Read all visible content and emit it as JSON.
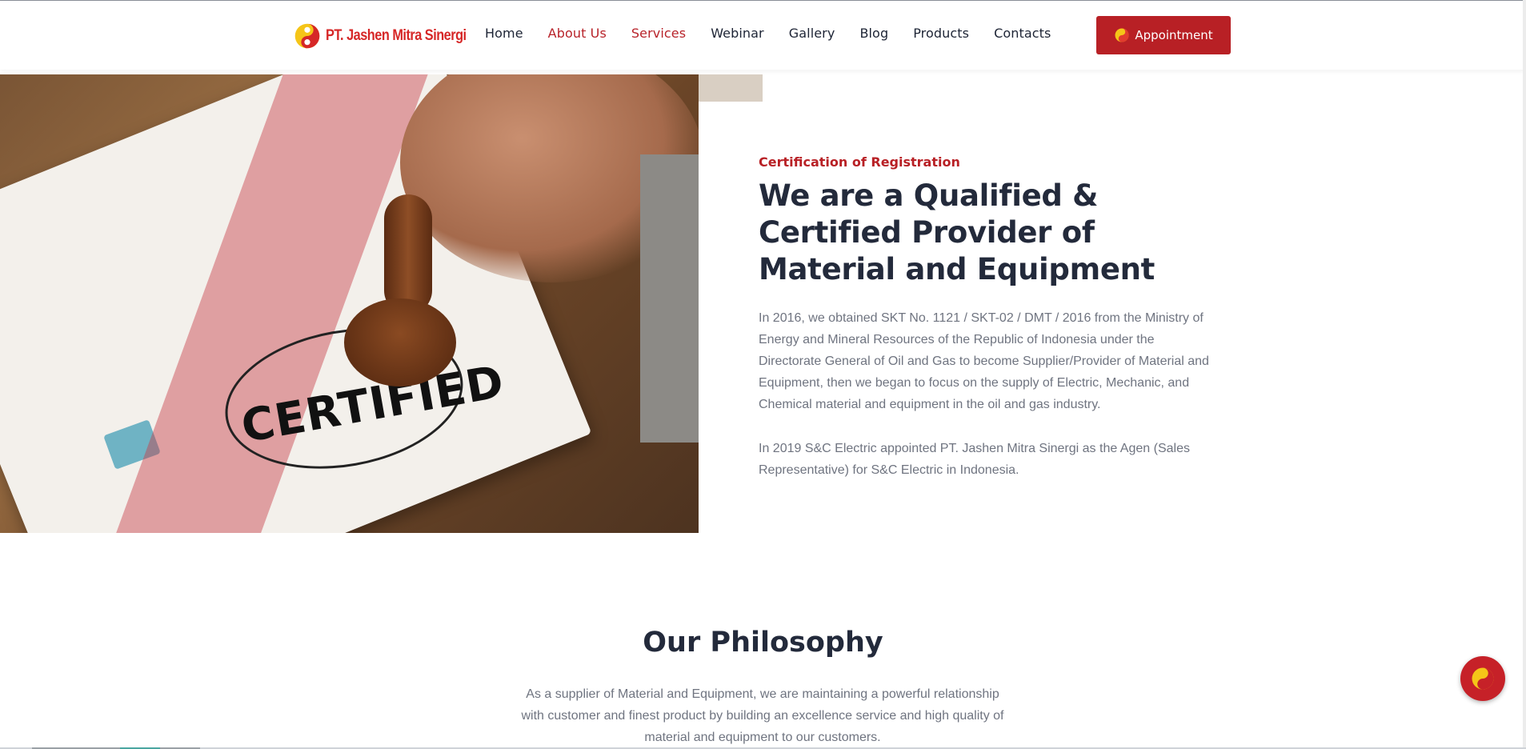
{
  "brand": {
    "name": "PT. Jashen Mitra Sinergi",
    "logo_icon": "jashen-swirl-logo",
    "accent": "#b82025",
    "logo_yellow": "#f5c518"
  },
  "nav": {
    "items": [
      {
        "label": "Home",
        "active": false
      },
      {
        "label": "About Us",
        "active": true
      },
      {
        "label": "Services",
        "active": true
      },
      {
        "label": "Webinar",
        "active": false
      },
      {
        "label": "Gallery",
        "active": false
      },
      {
        "label": "Blog",
        "active": false
      },
      {
        "label": "Products",
        "active": false
      },
      {
        "label": "Contacts",
        "active": false
      }
    ],
    "cta_label": "Appointment"
  },
  "hero": {
    "image_stamp_text": "CERTIFIED",
    "eyebrow": "Certification of Registration",
    "headline": "We are a Qualified & Certified Provider of Material and Equipment",
    "paragraph_1": "In 2016, we obtained SKT No. 1121 / SKT-02 / DMT / 2016 from the Ministry of Energy and Mineral Resources of the Republic of Indonesia under the Directorate General of Oil and Gas to become Supplier/Provider of Material and Equipment, then we began to focus on the supply of Electric, Mechanic, and Chemical material and equipment in the oil and gas industry.",
    "paragraph_2": "In 2019 S&C Electric appointed PT. Jashen Mitra Sinergi as the Agen (Sales Representative) for S&C Electric in Indonesia."
  },
  "philosophy": {
    "title": "Our Philosophy",
    "text": "As a supplier of Material and Equipment, we are maintaining a powerful relationship with customer and finest product by building an excellence service and high quality of material and equipment to our customers."
  },
  "floating_button": {
    "icon": "jashen-swirl-icon"
  }
}
